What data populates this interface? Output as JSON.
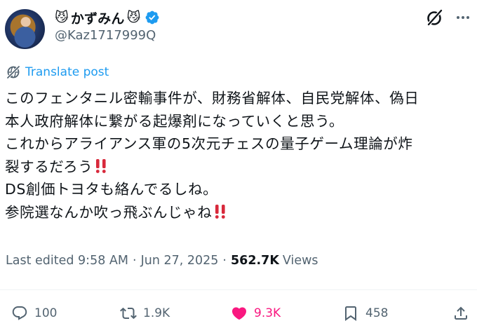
{
  "author": {
    "display_name": "かずみん",
    "name_emoji": "😼",
    "handle": "@Kaz1717999Q",
    "verified": true,
    "verified_color": "#1d9bf0"
  },
  "header_icons": [
    "grok-icon",
    "more-icon"
  ],
  "translate_label": "Translate post",
  "tweet": {
    "lines": [
      "このフェンタニル密輸事件が、財務省解体、自民党解体、偽日",
      "本人政府解体に繋がる起爆剤になっていくと思う。",
      "これからアライアンス軍の5次元チェスの量子ゲーム理論が炸",
      "裂するだろう",
      "DS創価トヨタも絡んでるしね。",
      "参院選なんか吹っ飛ぶんじゃね"
    ],
    "emphasis_emoji": "‼️"
  },
  "meta": {
    "edited": "Last edited 9:58 AM",
    "separator": "·",
    "date": "Jun 27, 2025",
    "views_count": "562.7K",
    "views_label": "Views"
  },
  "actions": {
    "replies": "100",
    "reposts": "1.9K",
    "likes": "9.3K",
    "bookmarks": "458"
  },
  "colors": {
    "like": "#f91880",
    "link": "#1d9bf0",
    "secondary_text": "#536471"
  }
}
